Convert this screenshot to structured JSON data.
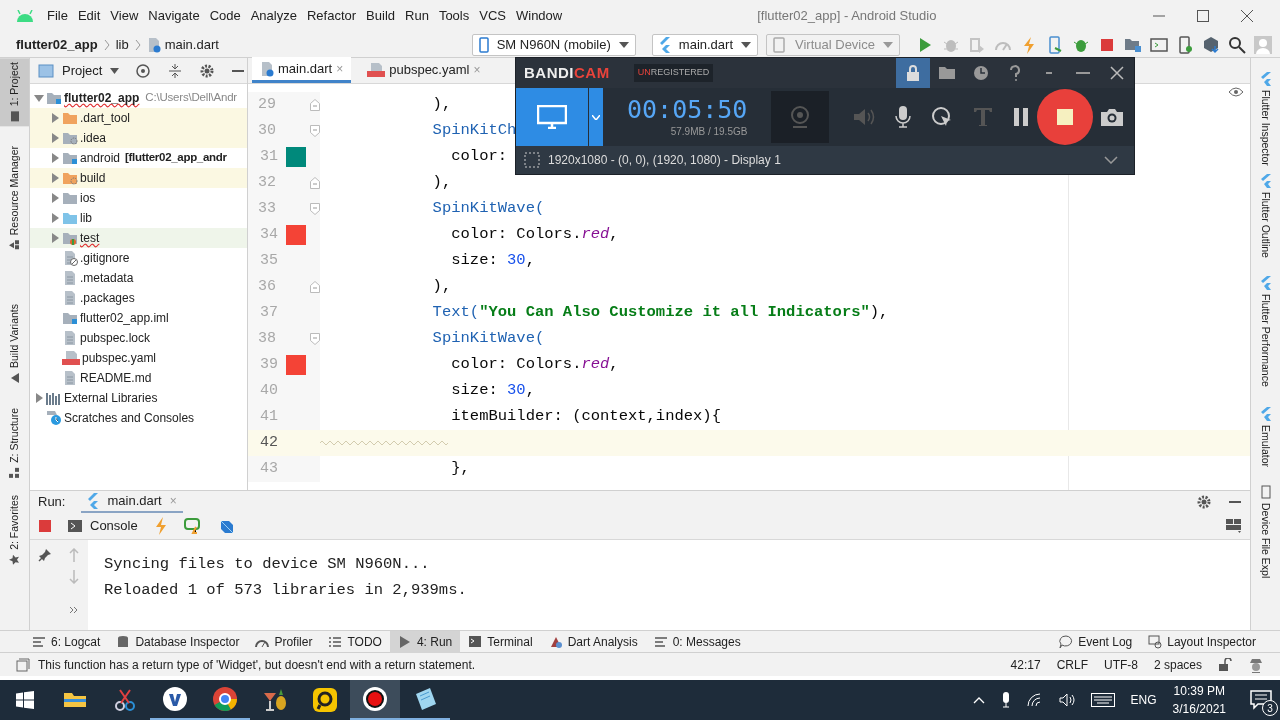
{
  "title_bar": {
    "menu": [
      "File",
      "Edit",
      "View",
      "Navigate",
      "Code",
      "Analyze",
      "Refactor",
      "Build",
      "Run",
      "Tools",
      "VCS",
      "Window"
    ],
    "title": "[flutter02_app] - Android Studio"
  },
  "navigation_bar": {
    "breadcrumbs": [
      "flutter02_app",
      "lib",
      "main.dart"
    ],
    "device": "SM N960N (mobile)",
    "run_config": "main.dart",
    "virtual_device": {
      "label": "Virtual Device",
      "disabled": true
    }
  },
  "left_tool_strip": [
    {
      "label": "1: Project",
      "selected": true
    },
    {
      "label": "Resource Manager",
      "selected": false
    },
    {
      "label": "Build Variants",
      "selected": false
    },
    {
      "label": "Z: Structure",
      "selected": false
    },
    {
      "label": "2: Favorites",
      "selected": false
    }
  ],
  "project_panel": {
    "title": "Project",
    "tree": [
      {
        "label": "flutter02_app",
        "path": "C:\\Users\\Dell\\Andr",
        "kind": "module",
        "expanded": true,
        "misspelled": true,
        "children": [
          {
            "label": ".dart_tool",
            "kind": "excluded-folder",
            "expanded": false,
            "misspelled": false,
            "color": "#fbf8e2"
          },
          {
            "label": ".idea",
            "kind": "config-folder",
            "expanded": false,
            "misspelled": false,
            "color": "#fbf8e2"
          },
          {
            "label": "android",
            "suffix": "[flutter02_app_andr",
            "kind": "module-folder",
            "expanded": false,
            "misspelled": false
          },
          {
            "label": "build",
            "kind": "build-folder",
            "expanded": false,
            "misspelled": false,
            "color": "#fbf8e2"
          },
          {
            "label": "ios",
            "kind": "folder",
            "expanded": false,
            "misspelled": false
          },
          {
            "label": "lib",
            "kind": "source-folder",
            "expanded": false,
            "misspelled": false
          },
          {
            "label": "test",
            "kind": "test-folder",
            "expanded": false,
            "misspelled": true,
            "color": "#eff5ea"
          },
          {
            "label": ".gitignore",
            "kind": "ignore-file",
            "misspelled": false
          },
          {
            "label": ".metadata",
            "kind": "text-file",
            "misspelled": false
          },
          {
            "label": ".packages",
            "kind": "text-file",
            "misspelled": false
          },
          {
            "label": "flutter02_app.iml",
            "kind": "module-file",
            "misspelled": false
          },
          {
            "label": "pubspec.lock",
            "kind": "text-file",
            "misspelled": false
          },
          {
            "label": "pubspec.yaml",
            "kind": "yaml-file",
            "misspelled": false
          },
          {
            "label": "README.md",
            "kind": "text-file",
            "misspelled": false
          }
        ]
      },
      {
        "label": "External Libraries",
        "kind": "libraries",
        "expanded": false,
        "misspelled": false
      },
      {
        "label": "Scratches and Consoles",
        "kind": "scratches",
        "misspelled": false
      }
    ]
  },
  "editor": {
    "tabs": [
      {
        "label": "main.dart",
        "close": "×",
        "kind": "dart",
        "selected": true
      },
      {
        "label": "pubspec.yaml",
        "close": "×",
        "kind": "yaml",
        "selected": false
      }
    ],
    "lines": [
      {
        "number": "29",
        "current": false,
        "warning": false,
        "fold_start": false,
        "fold_end": true,
        "tokens": [
          {
            "kind": "plain",
            "text": "            ),"
          }
        ]
      },
      {
        "number": "30",
        "current": false,
        "warning": false,
        "fold_start": true,
        "fold_end": false,
        "tokens": [
          {
            "kind": "class",
            "text": "            SpinKitCh"
          }
        ]
      },
      {
        "number": "31",
        "current": false,
        "warning": false,
        "fold_start": false,
        "fold_end": false,
        "color": "#00897b",
        "tokens": [
          {
            "kind": "plain",
            "text": "              color:"
          }
        ]
      },
      {
        "number": "32",
        "current": false,
        "warning": false,
        "fold_start": false,
        "fold_end": true,
        "tokens": [
          {
            "kind": "plain",
            "text": "            ),"
          }
        ]
      },
      {
        "number": "33",
        "current": false,
        "warning": false,
        "fold_start": true,
        "fold_end": false,
        "tokens": [
          {
            "kind": "class",
            "text": "            SpinKitWave("
          }
        ]
      },
      {
        "number": "34",
        "current": false,
        "warning": false,
        "fold_start": false,
        "fold_end": false,
        "color": "#f44336",
        "tokens": [
          {
            "kind": "plain",
            "text": "              color: Colors."
          },
          {
            "kind": "field",
            "text": "red"
          },
          {
            "kind": "plain",
            "text": ","
          }
        ]
      },
      {
        "number": "35",
        "current": false,
        "warning": false,
        "fold_start": false,
        "fold_end": false,
        "tokens": [
          {
            "kind": "plain",
            "text": "              size: "
          },
          {
            "kind": "number",
            "text": "30"
          },
          {
            "kind": "plain",
            "text": ","
          }
        ]
      },
      {
        "number": "36",
        "current": false,
        "warning": false,
        "fold_start": false,
        "fold_end": true,
        "tokens": [
          {
            "kind": "plain",
            "text": "            ),"
          }
        ]
      },
      {
        "number": "37",
        "current": false,
        "warning": false,
        "fold_start": false,
        "fold_end": false,
        "tokens": [
          {
            "kind": "class",
            "text": "            Text("
          },
          {
            "kind": "string",
            "text": "\"You Can Also Customize it all Indicators\""
          },
          {
            "kind": "plain",
            "text": "),"
          }
        ]
      },
      {
        "number": "38",
        "current": false,
        "warning": false,
        "fold_start": true,
        "fold_end": false,
        "tokens": [
          {
            "kind": "class",
            "text": "            SpinKitWave("
          }
        ]
      },
      {
        "number": "39",
        "current": false,
        "warning": false,
        "fold_start": false,
        "fold_end": false,
        "color": "#f44336",
        "tokens": [
          {
            "kind": "plain",
            "text": "              color: Colors."
          },
          {
            "kind": "field",
            "text": "red"
          },
          {
            "kind": "plain",
            "text": ","
          }
        ]
      },
      {
        "number": "40",
        "current": false,
        "warning": false,
        "fold_start": false,
        "fold_end": false,
        "tokens": [
          {
            "kind": "plain",
            "text": "              size: "
          },
          {
            "kind": "number",
            "text": "30"
          },
          {
            "kind": "plain",
            "text": ","
          }
        ]
      },
      {
        "number": "41",
        "current": false,
        "warning": false,
        "fold_start": false,
        "fold_end": false,
        "tokens": [
          {
            "kind": "plain",
            "text": "              itemBuilder: (context,index){"
          }
        ]
      },
      {
        "number": "42",
        "current": true,
        "warning": true,
        "fold_start": false,
        "fold_end": false
      },
      {
        "number": "43",
        "current": false,
        "warning": false,
        "fold_start": false,
        "fold_end": false,
        "tokens": [
          {
            "kind": "plain",
            "text": "              },"
          }
        ]
      }
    ]
  },
  "right_tool_strip": [
    "Flutter Inspector",
    "Flutter Outline",
    "Flutter Performance",
    "Emulator",
    "Device File Expl"
  ],
  "bandicam": {
    "logo": [
      "BANDI",
      "CAM"
    ],
    "badge": [
      "UN",
      "REGISTERED"
    ],
    "locked": true,
    "timer": "00:05:50",
    "file_size": "57.9MB / 19.5GB",
    "capture_area": "1920x1080 - (0, 0), (1920, 1080) - Display 1"
  },
  "run_panel": {
    "label": "Run:",
    "tab": "main.dart",
    "tab_close": "×",
    "console_tab": "Console",
    "output": [
      "Syncing files to device SM N960N...",
      "Reloaded 1 of 573 libraries in 2,939ms."
    ]
  },
  "tool_windows": {
    "left": [
      {
        "label": "6: Logcat",
        "kind": "logcat",
        "selected": false
      },
      {
        "label": "Database Inspector",
        "kind": "database",
        "selected": false
      },
      {
        "label": "Profiler",
        "kind": "profiler",
        "selected": false
      },
      {
        "label": "TODO",
        "kind": "todo",
        "selected": false
      },
      {
        "label": "4: Run",
        "kind": "run",
        "selected": true
      },
      {
        "label": "Terminal",
        "kind": "terminal",
        "selected": false
      },
      {
        "label": "Dart Analysis",
        "kind": "analysis",
        "selected": false
      },
      {
        "label": "0: Messages",
        "kind": "messages",
        "selected": false
      }
    ],
    "right": [
      {
        "label": "Event Log",
        "kind": "log",
        "selected": false
      },
      {
        "label": "Layout Inspector",
        "kind": "inspector",
        "selected": false
      }
    ]
  },
  "status_bar": {
    "message": "This function has a return type of 'Widget', but doesn't end with a return statement.",
    "items": [
      "42:17",
      "CRLF",
      "UTF-8",
      "2 spaces"
    ]
  },
  "taskbar": {
    "apps": [
      {
        "kind": "folder",
        "running": false,
        "selected": false
      },
      {
        "kind": "scissors",
        "running": false,
        "selected": false
      },
      {
        "kind": "round",
        "running": true,
        "selected": false
      },
      {
        "kind": "browser",
        "running": true,
        "selected": false
      },
      {
        "kind": "drink",
        "running": false,
        "selected": false
      },
      {
        "kind": "square",
        "running": false,
        "selected": false
      },
      {
        "kind": "record",
        "running": true,
        "selected": true
      },
      {
        "kind": "notepad",
        "running": true,
        "selected": false
      }
    ],
    "language": "ENG",
    "time": "10:39 PM",
    "date": "3/16/2021",
    "notifications": "3"
  }
}
